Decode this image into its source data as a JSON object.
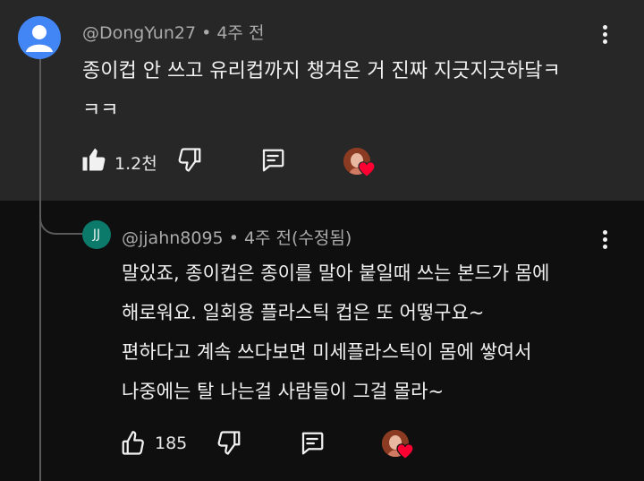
{
  "comment": {
    "author": "@DongYun27",
    "time": "4주 전",
    "lines": [
      "종이컵 안 쓰고 유리컵까지 챙겨온 거 진짜 지긋지긋하닼ㅋ",
      "ㅋㅋ"
    ],
    "likes": "1.2천",
    "icons": [
      "like-filled-icon",
      "dislike-icon",
      "reply-icon",
      "creator-heart-icon",
      "more-icon"
    ]
  },
  "reply": {
    "avatar_initials": "JJ",
    "author": "@jjahn8095",
    "time": "4주 전(수정됨)",
    "lines": [
      "말있죠, 종이컵은 종이를 말아 붙일때 쓰는 본드가 몸에",
      "해로워요. 일회용 플라스틱 컵은 또 어떻구요~",
      "편하다고 계속 쓰다보면 미세플라스틱이 몸에 쌓여서",
      "나중에는 탈 나는걸 사람들이 그걸 몰라~"
    ],
    "likes": "185",
    "icons": [
      "like-outline-icon",
      "dislike-icon",
      "reply-icon",
      "creator-heart-icon",
      "more-icon"
    ]
  },
  "colors": {
    "comment_bg": "#272727",
    "page_bg": "#0f0f0f",
    "avatar1": "#4285f4",
    "avatar2": "#0b7a6a",
    "heart": "#ff0033"
  }
}
